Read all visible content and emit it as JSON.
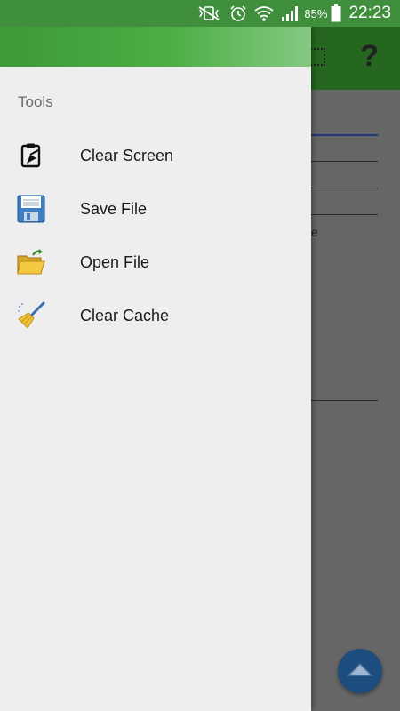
{
  "status_bar": {
    "battery_percent": "85%",
    "time": "22:23",
    "icons": [
      "mute-vibrate-icon",
      "alarm-icon",
      "wifi-icon",
      "signal-icon",
      "battery-icon"
    ]
  },
  "background_app": {
    "toolbar_icons": [
      "grid-icon",
      "help-icon"
    ],
    "help_glyph": "?",
    "visible_fragment": "e",
    "fab_icon": "chevron-up-icon"
  },
  "drawer": {
    "section_title": "Tools",
    "items": [
      {
        "label": "Clear Screen",
        "icon": "clipboard-icon"
      },
      {
        "label": "Save File",
        "icon": "floppy-disk-icon"
      },
      {
        "label": "Open File",
        "icon": "open-folder-icon"
      },
      {
        "label": "Clear Cache",
        "icon": "broom-icon"
      }
    ]
  },
  "colors": {
    "status_bar": "#3f8f3c",
    "drawer_header_start": "#3c9a37",
    "drawer_header_end": "#86c983",
    "drawer_bg": "#eeeeee",
    "scrim": "#6b6b6b",
    "fab": "#1d4c7e"
  }
}
